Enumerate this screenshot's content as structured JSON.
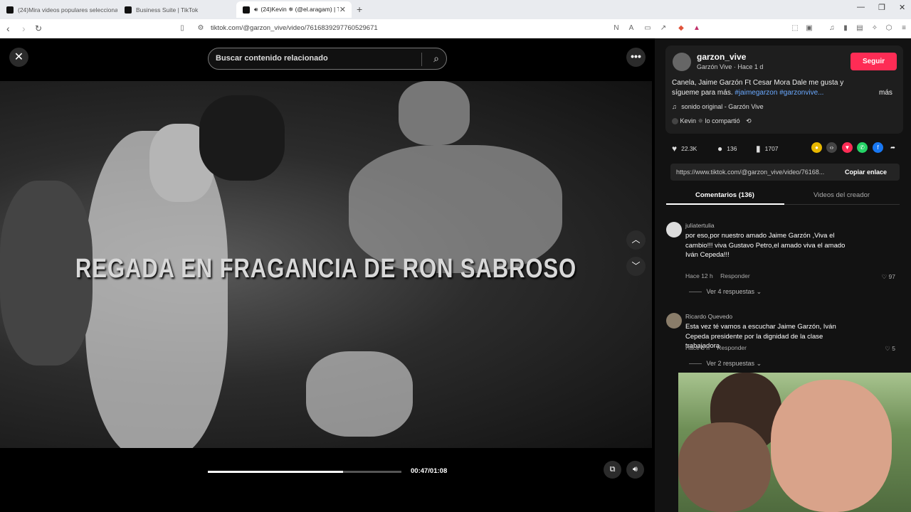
{
  "browser": {
    "tabs": [
      {
        "title": "(24)Mira videos populares seleccionad"
      },
      {
        "title": "Business Suite | TikTok"
      },
      {
        "title": "(24)Kevin ✵ (@el.aragam) | T"
      }
    ],
    "url": "tiktok.com/@garzon_vive/video/7616839297760529671"
  },
  "player": {
    "search_placeholder": "Buscar contenido relacionado",
    "caption": "REGADA EN FRAGANCIA DE RON SABROSO",
    "time": "00:47/01:08",
    "progress": 0.7
  },
  "post": {
    "username": "garzon_vive",
    "subline": "Garzón Vive · Hace 1 d",
    "follow_label": "Seguir",
    "description": "Canela, Jaime Garzón Ft Cesar Mora Dale me gusta y sígueme para más.",
    "hashtags": "#jaimegarzon #garzonvive...",
    "more_label": "más",
    "sound": "sonido original - Garzón Vive",
    "shared_user": "Kevin",
    "shared_label": "lo compartió",
    "likes": "22.3K",
    "comments": "136",
    "saves": "1707",
    "link": "https://www.tiktok.com/@garzon_vive/video/76168...",
    "copy_label": "Copiar enlace",
    "tab_comments": "Comentarios (136)",
    "tab_videos": "Videos del creador"
  },
  "comments": [
    {
      "user": "juliatertulia",
      "text": "por eso,por nuestro amado Jaime Garzón ,Viva el cambio!!! viva Gustavo Petro,el amado viva el amado Iván Cepeda!!!",
      "time": "Hace 12 h",
      "reply": "Responder",
      "likes": "97",
      "replies": "Ver 4 respuestas"
    },
    {
      "user": "Ricardo Quevedo",
      "text": "Esta vez té vamos a escuchar Jaime Garzón, Iván Cepeda presidente por la dignidad de la clase trabajadora",
      "time": "Hace 5 h",
      "reply": "Responder",
      "likes": "5",
      "replies": "Ver 2 respuestas"
    }
  ],
  "colors": {
    "accent": "#fe2c55",
    "hashtag": "#6aa9ff",
    "panel_bg": "#121212"
  }
}
